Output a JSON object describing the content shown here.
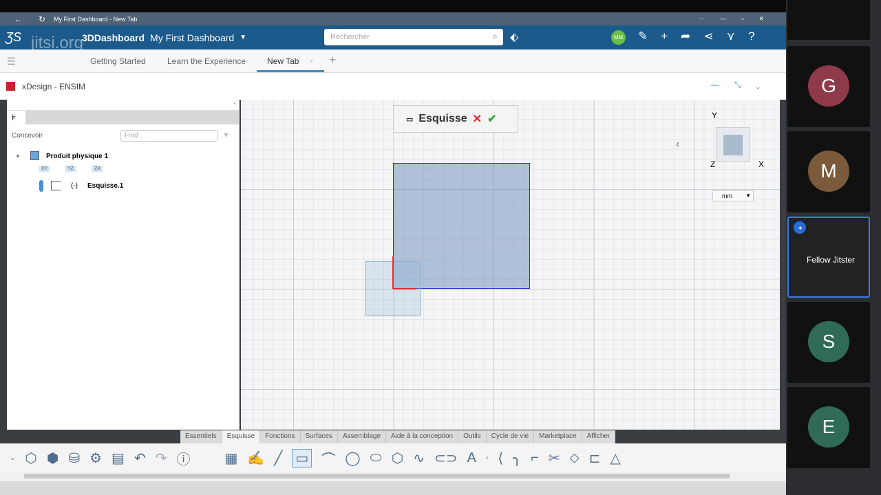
{
  "browser": {
    "title": "My First Dashboard - New Tab"
  },
  "header": {
    "app": "3DDashboard",
    "dashboard": "My First Dashboard",
    "search_placeholder": "Rechercher",
    "user_initials": "MM",
    "watermark": "jitsi.org"
  },
  "tabs": [
    {
      "label": "Getting Started"
    },
    {
      "label": "Learn the Experience"
    },
    {
      "label": "New Tab"
    }
  ],
  "app": {
    "title": "xDesign - ENSIM"
  },
  "tree": {
    "section": "Concevoir",
    "find_placeholder": "Find ...",
    "root": "Produit physique 1",
    "planes": [
      "XY",
      "YZ",
      "ZX"
    ],
    "sketch_prefix": "(-)",
    "sketch": "Esquisse.1"
  },
  "sketch_bar": {
    "label": "Esquisse"
  },
  "viewcube": {
    "y": "Y",
    "z": "Z",
    "x": "X"
  },
  "units": {
    "value": "mm"
  },
  "toolbar_tabs": [
    {
      "label": "Essentiels"
    },
    {
      "label": "Esquisse"
    },
    {
      "label": "Fonctions"
    },
    {
      "label": "Surfaces"
    },
    {
      "label": "Assemblage"
    },
    {
      "label": "Aide à la conception"
    },
    {
      "label": "Outils"
    },
    {
      "label": "Cycle de vie"
    },
    {
      "label": "Marketplace"
    },
    {
      "label": "Afficher"
    }
  ],
  "participants": [
    {
      "initial": "G",
      "color": "#8e3a4a"
    },
    {
      "initial": "M",
      "color": "#7a5a3a"
    },
    {
      "name": "Fellow Jitster"
    },
    {
      "initial": "S",
      "color": "#2f6b57"
    },
    {
      "initial": "E",
      "color": "#2f6b57"
    }
  ]
}
